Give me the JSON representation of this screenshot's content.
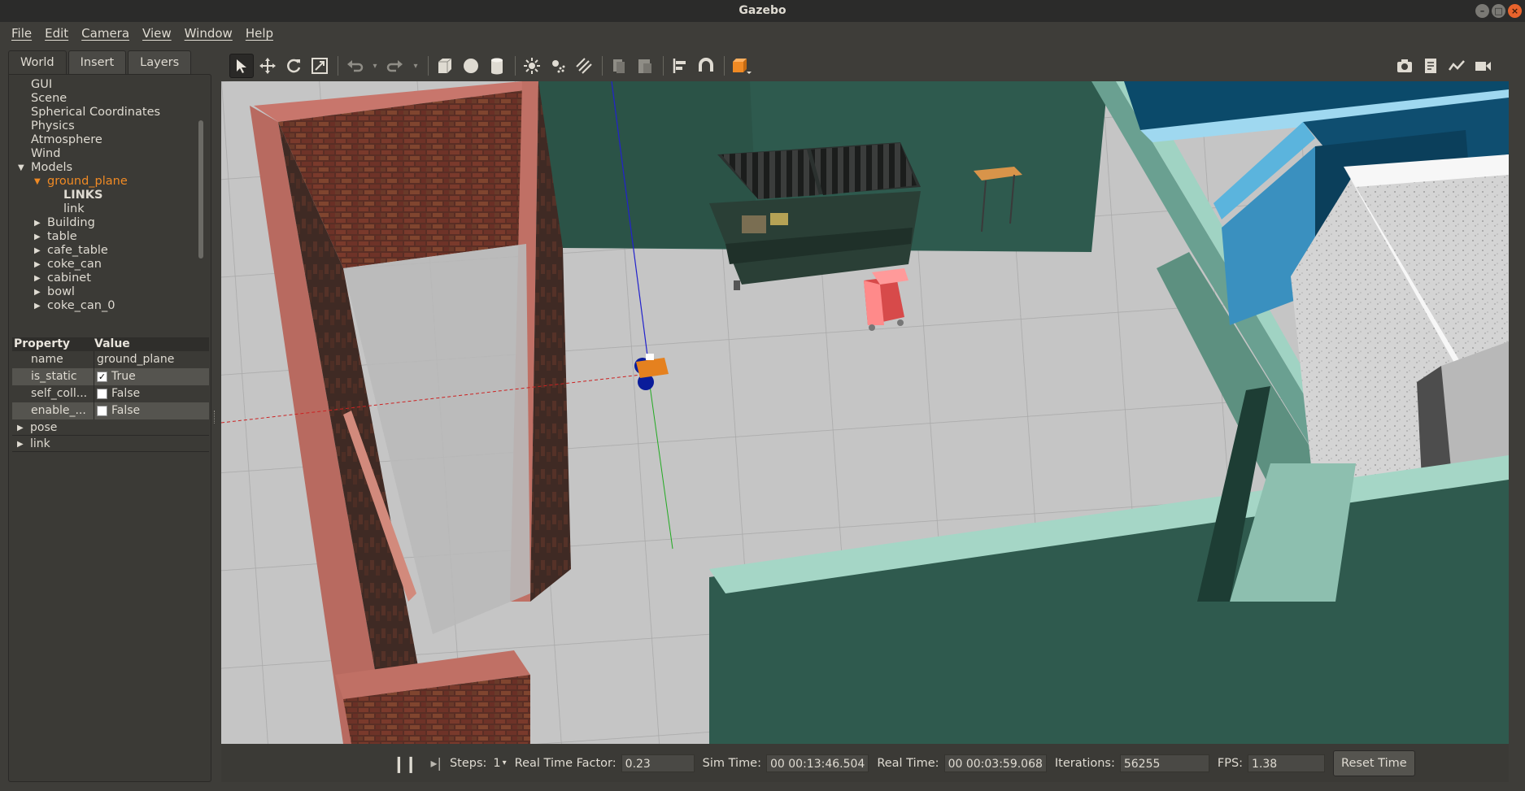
{
  "window": {
    "title": "Gazebo"
  },
  "menu": [
    "File",
    "Edit",
    "Camera",
    "View",
    "Window",
    "Help"
  ],
  "left_panel": {
    "tabs": [
      "World",
      "Insert",
      "Layers"
    ],
    "active_tab": "World",
    "tree": [
      {
        "label": "GUI",
        "level": 1
      },
      {
        "label": "Scene",
        "level": 1
      },
      {
        "label": "Spherical Coordinates",
        "level": 1
      },
      {
        "label": "Physics",
        "level": 1
      },
      {
        "label": "Atmosphere",
        "level": 1
      },
      {
        "label": "Wind",
        "level": 1
      },
      {
        "label": "Models",
        "level": 1,
        "expanded": true
      },
      {
        "label": "ground_plane",
        "level": 2,
        "expanded": true,
        "selected": true
      },
      {
        "label": "LINKS",
        "level": 3,
        "bold": true
      },
      {
        "label": "link",
        "level": 3
      },
      {
        "label": "Building",
        "level": 2,
        "collapsed": true
      },
      {
        "label": "table",
        "level": 2,
        "collapsed": true
      },
      {
        "label": "cafe_table",
        "level": 2,
        "collapsed": true
      },
      {
        "label": "coke_can",
        "level": 2,
        "collapsed": true
      },
      {
        "label": "cabinet",
        "level": 2,
        "collapsed": true
      },
      {
        "label": "bowl",
        "level": 2,
        "collapsed": true
      },
      {
        "label": "coke_can_0",
        "level": 2,
        "collapsed": true
      }
    ],
    "properties": {
      "header_property": "Property",
      "header_value": "Value",
      "rows": [
        {
          "key": "name",
          "value": "ground_plane",
          "checkbox": null
        },
        {
          "key": "is_static",
          "value": "True",
          "checkbox": true
        },
        {
          "key": "self_coll...",
          "value": "False",
          "checkbox": false
        },
        {
          "key": "enable_...",
          "value": "False",
          "checkbox": false
        }
      ],
      "expandables": [
        "pose",
        "link"
      ]
    }
  },
  "toolbar": {
    "left_icons": [
      "select-arrow-icon",
      "translate-icon",
      "rotate-icon",
      "scale-icon",
      "undo-icon",
      "undo-dropdown-icon",
      "redo-icon",
      "redo-dropdown-icon",
      "box-shape-icon",
      "sphere-shape-icon",
      "cylinder-shape-icon",
      "point-light-icon",
      "spot-light-icon",
      "directional-light-icon",
      "copy-icon",
      "paste-icon",
      "align-icon",
      "snap-icon",
      "view-angle-icon"
    ],
    "right_icons": [
      "screenshot-icon",
      "log-icon",
      "plot-icon",
      "record-video-icon"
    ]
  },
  "bottom_bar": {
    "steps_label": "Steps:",
    "steps_value": "1",
    "rtf_label": "Real Time Factor:",
    "rtf_value": "0.23",
    "sim_time_label": "Sim Time:",
    "sim_time_value": "00 00:13:46.504",
    "real_time_label": "Real Time:",
    "real_time_value": "00 00:03:59.068",
    "iterations_label": "Iterations:",
    "iterations_value": "56255",
    "fps_label": "FPS:",
    "fps_value": "1.38",
    "reset_label": "Reset Time"
  }
}
